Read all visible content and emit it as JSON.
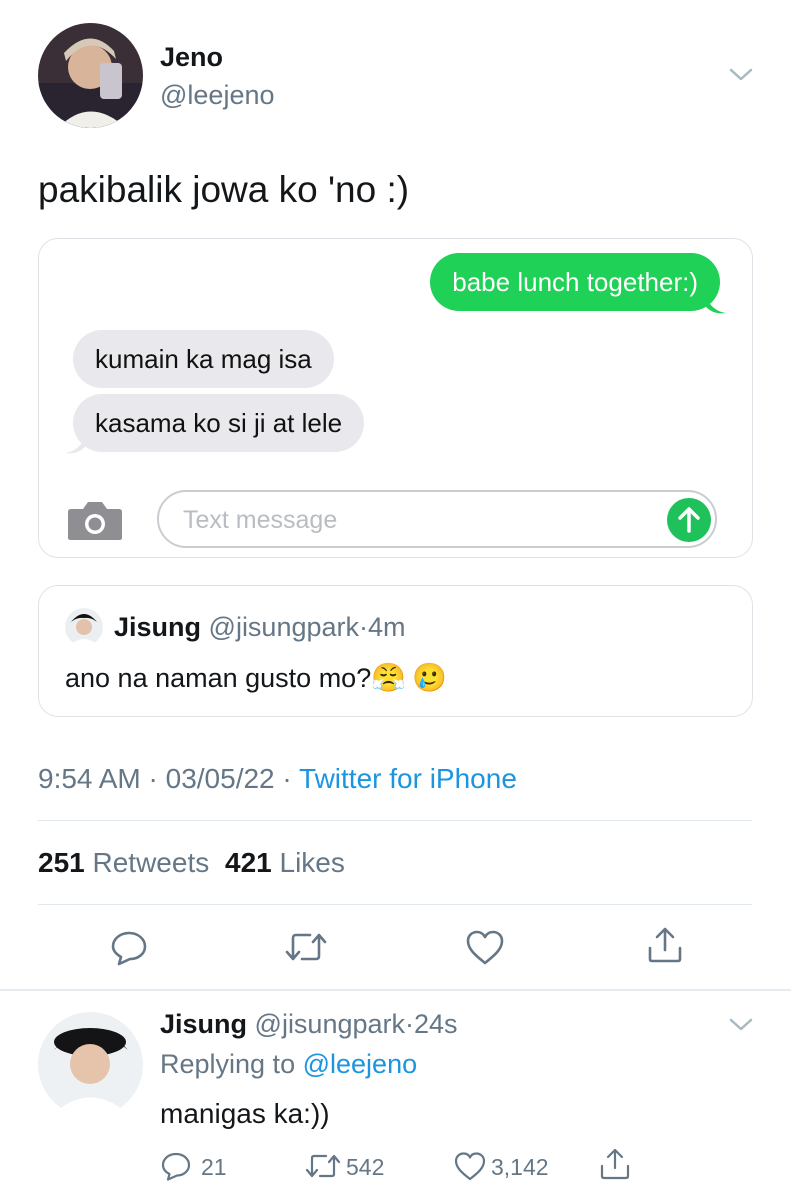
{
  "tweet": {
    "author_name": "Jeno",
    "author_handle": "@leejeno",
    "text": "pakibalik jowa ko 'no :)",
    "message_card": {
      "outgoing": "babe lunch together:)",
      "incoming": [
        "kumain ka mag isa",
        "kasama ko si ji at lele"
      ],
      "input_placeholder": "Text message"
    },
    "quote": {
      "name": "Jisung",
      "handle": "@jisungpark",
      "time": "4m",
      "text": "ano na naman gusto mo?",
      "emojis": [
        "😤",
        "🥲"
      ]
    },
    "time": "9:54 AM",
    "date": "03/05/22",
    "source": "Twitter for iPhone",
    "retweets": "251",
    "retweets_label": "Retweets",
    "likes": "421",
    "likes_label": "Likes"
  },
  "reply": {
    "name": "Jisung",
    "handle": "@jisungpark",
    "time": "24s",
    "replying_to_label": "Replying to",
    "replying_to_handle": "@leejeno",
    "text": "manigas ka:))",
    "replies": "21",
    "retweets": "542",
    "likes": "3,142"
  },
  "colors": {
    "imessage_green": "#1fd156",
    "twitter_blue": "#1b95e0",
    "muted": "#657786"
  },
  "icons": [
    "chevron-down-icon",
    "camera-icon",
    "send-arrow-icon",
    "reply-icon",
    "retweet-icon",
    "like-icon",
    "share-icon"
  ]
}
